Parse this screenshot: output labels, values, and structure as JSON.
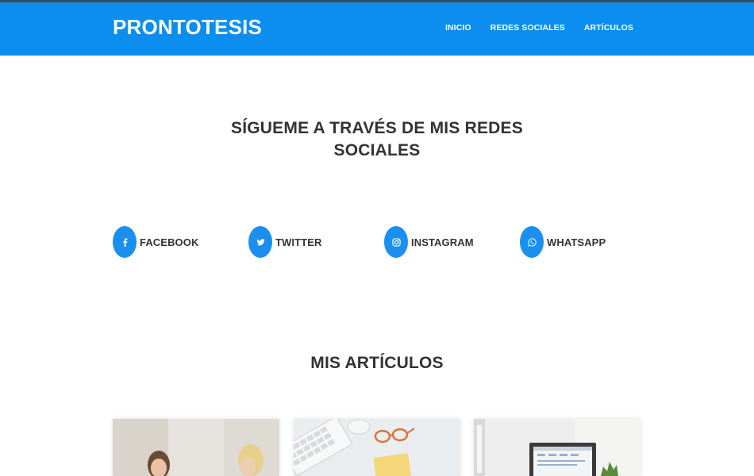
{
  "navbar": {
    "brand": "PRONTOTESIS",
    "links": [
      "INICIO",
      "REDES SOCIALES",
      "ARTÍCULOS"
    ],
    "color": "#0b8ef0"
  },
  "social_section": {
    "title_line1": "SÍGUEME A TRAVÉS DE MIS REDES",
    "title_line2": "SOCIALES",
    "items": [
      {
        "label": "FACEBOOK",
        "icon": "facebook-icon"
      },
      {
        "label": "TWITTER",
        "icon": "twitter-icon"
      },
      {
        "label": "INSTAGRAM",
        "icon": "instagram-icon"
      },
      {
        "label": "WHATSAPP",
        "icon": "whatsapp-icon"
      }
    ]
  },
  "articles_section": {
    "title": "MIS ARTÍCULOS",
    "cards": [
      {
        "image": "two-women-photo"
      },
      {
        "image": "desk-keyboard-glasses-photo"
      },
      {
        "image": "laptop-office-photo"
      }
    ]
  }
}
